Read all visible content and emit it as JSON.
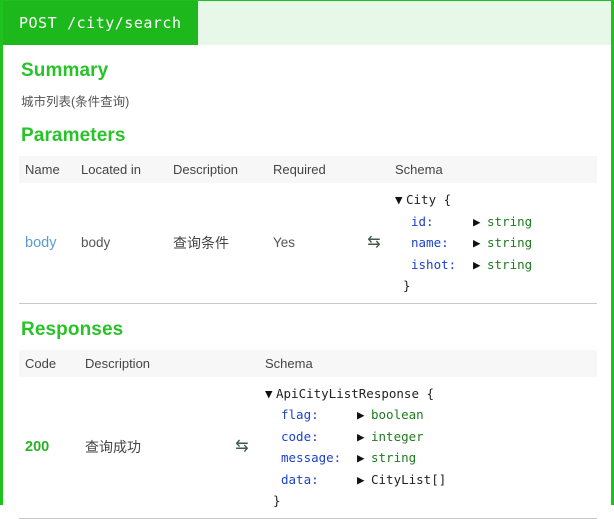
{
  "endpoint": {
    "method": "POST",
    "path": "/city/search"
  },
  "summary": {
    "heading": "Summary",
    "text": "城市列表(条件查询)"
  },
  "parameters": {
    "heading": "Parameters",
    "columns": [
      "Name",
      "Located in",
      "Description",
      "Required",
      "Schema"
    ],
    "rows": [
      {
        "name": "body",
        "located_in": "body",
        "description": "查询条件",
        "required": "Yes",
        "toggle_icon": "swap-icon",
        "schema": {
          "caret": "▼",
          "model": "City",
          "open_brace": "{",
          "close_brace": "}",
          "properties": [
            {
              "key": "id:",
              "caret": "▶",
              "type": "string",
              "is_ref": false
            },
            {
              "key": "name:",
              "caret": "▶",
              "type": "string",
              "is_ref": false
            },
            {
              "key": "ishot:",
              "caret": "▶",
              "type": "string",
              "is_ref": false
            }
          ]
        }
      }
    ]
  },
  "responses": {
    "heading": "Responses",
    "columns": [
      "Code",
      "Description",
      "Schema"
    ],
    "rows": [
      {
        "code": "200",
        "description": "查询成功",
        "toggle_icon": "swap-icon",
        "schema": {
          "caret": "▼",
          "model": "ApiCityListResponse",
          "open_brace": "{",
          "close_brace": "}",
          "properties": [
            {
              "key": "flag:",
              "caret": "▶",
              "type": "boolean",
              "is_ref": false
            },
            {
              "key": "code:",
              "caret": "▶",
              "type": "integer",
              "is_ref": false
            },
            {
              "key": "message:",
              "caret": "▶",
              "type": "string",
              "is_ref": false
            },
            {
              "key": "data:",
              "caret": "▶",
              "type": "CityList[]",
              "is_ref": true
            }
          ]
        }
      }
    ]
  },
  "colors": {
    "method_green": "#1cb81c",
    "header_strip": "#e8f8e8",
    "section_heading": "#29c329",
    "link_blue": "#5b9bd5",
    "prop_key_blue": "#1e42c8",
    "type_green": "#1f7a1f",
    "table_header_bg": "#f7f7f7",
    "divider": "#c8c8c8"
  }
}
